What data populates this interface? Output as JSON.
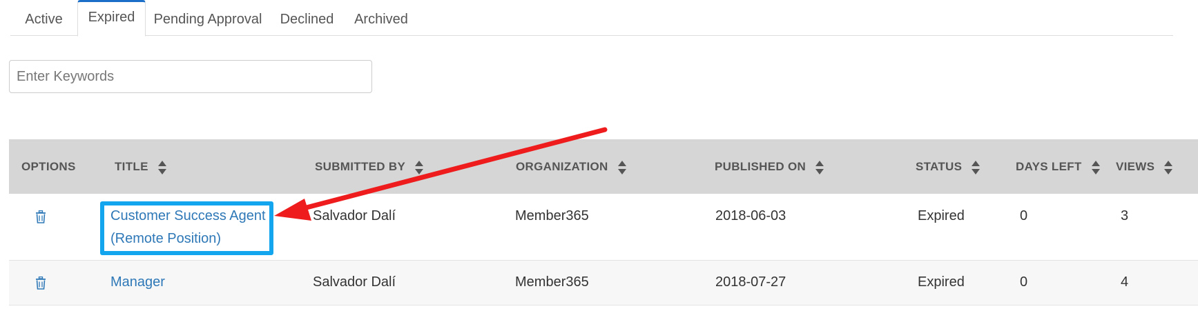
{
  "tabs": [
    {
      "label": "Active",
      "active": false
    },
    {
      "label": "Expired",
      "active": true
    },
    {
      "label": "Pending Approval",
      "active": false
    },
    {
      "label": "Declined",
      "active": false
    },
    {
      "label": "Archived",
      "active": false
    }
  ],
  "search": {
    "placeholder": "Enter Keywords",
    "value": ""
  },
  "table": {
    "columns": {
      "options": "OPTIONS",
      "title": "TITLE",
      "submitted_by": "SUBMITTED BY",
      "organization": "ORGANIZATION",
      "published_on": "PUBLISHED ON",
      "status": "STATUS",
      "days_left": "DAYS LEFT",
      "views": "VIEWS"
    },
    "rows": [
      {
        "title_line1": "Customer Success Agent",
        "title_line2": "(Remote Position)",
        "submitted_by": "Salvador Dalí",
        "organization": "Member365",
        "published_on": "2018-06-03",
        "status": "Expired",
        "days_left": "0",
        "views": "3"
      },
      {
        "title_line1": "Manager",
        "submitted_by": "Salvador Dalí",
        "organization": "Member365",
        "published_on": "2018-07-27",
        "status": "Expired",
        "days_left": "0",
        "views": "4"
      }
    ]
  },
  "colors": {
    "accent": "#1b6fc8",
    "link": "#2e78b7",
    "header_bg": "#d6d6d6",
    "highlight": "#13a6ef",
    "arrow": "#ee1c1c"
  },
  "icons": {
    "delete": "trash-icon",
    "sort": "sort-icon"
  }
}
